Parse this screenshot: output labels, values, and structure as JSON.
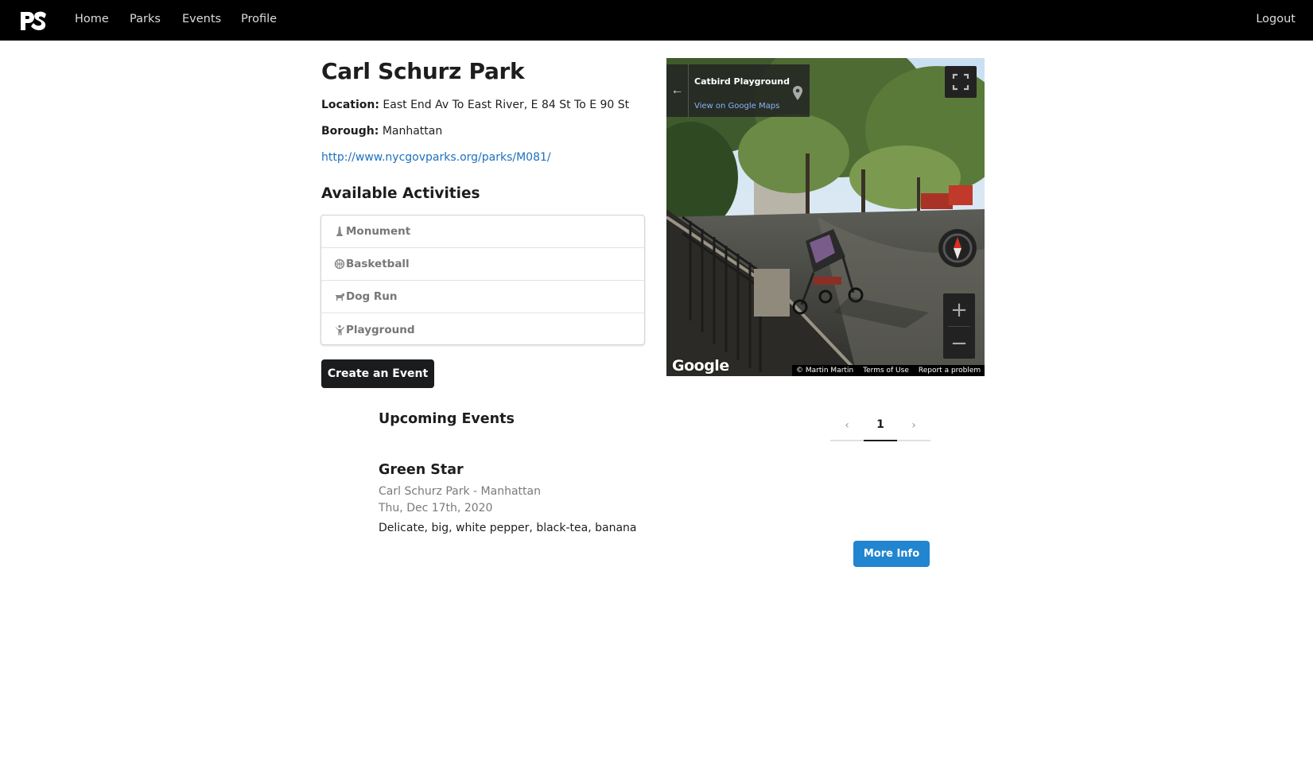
{
  "nav": {
    "logo_text": "PS",
    "links": [
      {
        "label": "Home"
      },
      {
        "label": "Parks"
      },
      {
        "label": "Events"
      },
      {
        "label": "Profile"
      }
    ],
    "logout_label": "Logout"
  },
  "park": {
    "name": "Carl Schurz Park",
    "location_label": "Location:",
    "location_value": "East End Av To East River, E 84 St To E 90 St",
    "borough_label": "Borough:",
    "borough_value": "Manhattan",
    "url": "http://www.nycgovparks.org/parks/M081/"
  },
  "activities": {
    "title": "Available Activities",
    "items": [
      {
        "label": "Monument",
        "icon": "monument-icon"
      },
      {
        "label": "Basketball",
        "icon": "basketball-icon"
      },
      {
        "label": "Dog Run",
        "icon": "dog-icon"
      },
      {
        "label": "Playground",
        "icon": "child-icon"
      }
    ]
  },
  "create_event_label": "Create an Event",
  "streetview": {
    "place_name": "Catbird Playground",
    "view_link": "View on Google Maps",
    "google_logo": "Google",
    "footer": {
      "copyright": "© Martin Martin",
      "terms": "Terms of Use",
      "report": "Report a problem"
    }
  },
  "events": {
    "title": "Upcoming Events",
    "pagination": {
      "prev": "‹",
      "current": "1",
      "next": "›"
    },
    "items": [
      {
        "name": "Green Star",
        "location": "Carl Schurz Park - Manhattan",
        "date": "Thu, Dec 17th, 2020",
        "description": "Delicate, big, white pepper, black-tea, banana",
        "button_label": "More Info"
      }
    ]
  },
  "colors": {
    "navbar": "#000000",
    "primary_button": "#2185d0",
    "dark_button": "#1b1c1d",
    "link": "#1e70bf"
  }
}
